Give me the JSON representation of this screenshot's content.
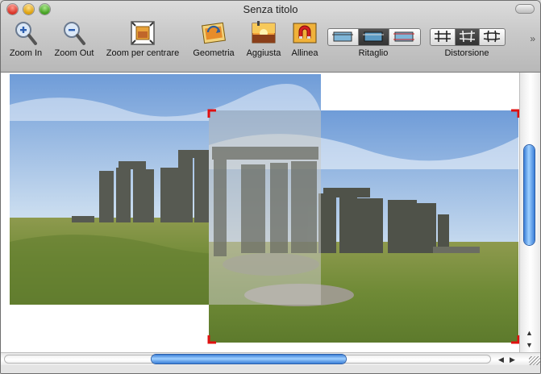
{
  "window": {
    "title": "Senza titolo"
  },
  "toolbar": {
    "zoom_in": "Zoom In",
    "zoom_out": "Zoom Out",
    "zoom_center": "Zoom per centrare",
    "geometry": "Geometria",
    "adjust": "Aggiusta",
    "align": "Allinea",
    "crop": "Ritaglio",
    "distortion": "Distorsione"
  },
  "colors": {
    "selection_corner": "#e01010",
    "scroll_thumb": "#5aa0ef"
  },
  "icons": {
    "zoom_in": "magnifier-plus-icon",
    "zoom_out": "magnifier-minus-icon",
    "zoom_center": "frame-fit-icon",
    "geometry": "rotate-photo-icon",
    "adjust": "sunset-adjust-icon",
    "align": "magnet-icon",
    "overflow": "chevron-right-double-icon"
  }
}
